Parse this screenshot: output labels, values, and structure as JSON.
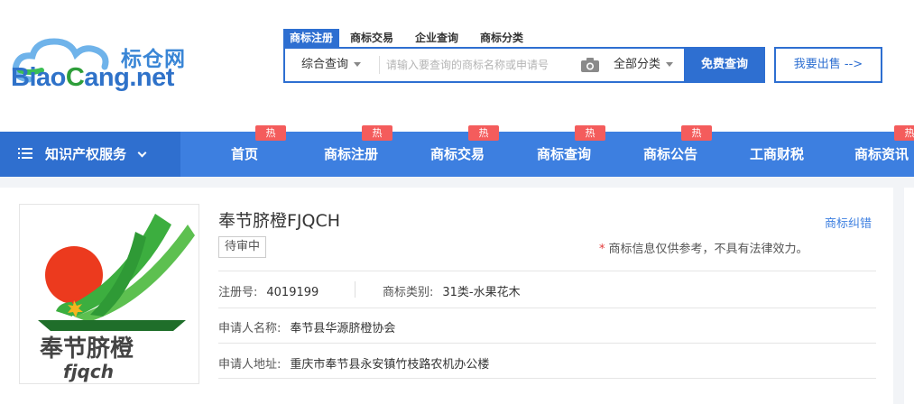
{
  "logo": {
    "cn": "标仓网",
    "en_blue_1": "Biao",
    "en_green": "C",
    "en_blue_2": "ang.net"
  },
  "search": {
    "tabs": [
      "商标注册",
      "商标交易",
      "企业查询",
      "商标分类"
    ],
    "type": "综合查询",
    "placeholder": "请输入要查询的商标名称或申请号",
    "category": "全部分类",
    "button": "免费查询"
  },
  "sell_button": "我要出售 -->",
  "nav": {
    "services": "知识产权服务",
    "hot_label": "热",
    "items": [
      "首页",
      "商标注册",
      "商标交易",
      "商标查询",
      "商标公告",
      "工商财税",
      "商标资讯"
    ]
  },
  "trademark": {
    "title": "奉节脐橙FJQCH",
    "status": "待审中",
    "correct_link": "商标纠错",
    "notice": "商标信息仅供参考，不具有法律效力。",
    "reg_label": "注册号:",
    "reg_value": "4019199",
    "class_label": "商标类别:",
    "class_value": "31类-水果花木",
    "applicant_label": "申请人名称:",
    "applicant_value": "奉节县华源脐橙协会",
    "address_label": "申请人地址:",
    "address_value": "重庆市奉节县永安镇竹枝路农机办公楼",
    "image_text_cn": "奉节脐橙",
    "image_text_en": "fjqch"
  },
  "colors": {
    "primary": "#2e6fd1",
    "nav": "#3d7fe0",
    "hot": "#f45c5c",
    "green": "#2e9e3a"
  }
}
